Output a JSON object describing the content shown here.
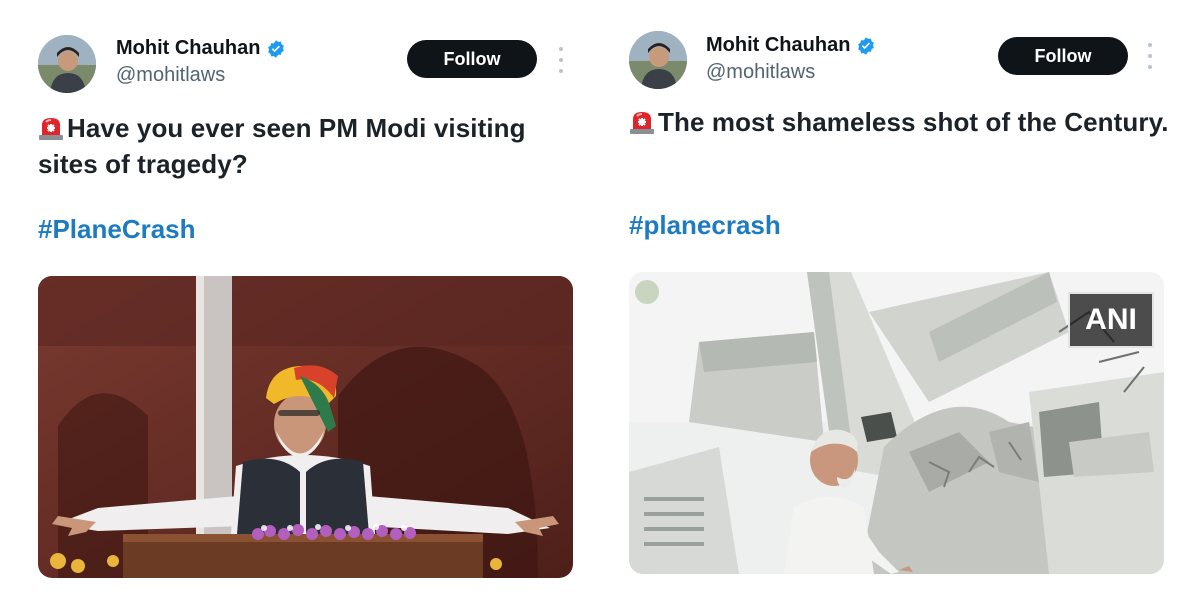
{
  "tweets": [
    {
      "author": {
        "display_name": "Mohit Chauhan",
        "handle": "@mohitlaws",
        "verified_icon": "verified-badge-icon"
      },
      "follow_label": "Follow",
      "text": "Have you ever seen PM Modi visiting sites of tragedy?",
      "text_prefix_icon": "police-siren-icon",
      "hashtag": "#PlaneCrash",
      "media": {
        "description_icon": "photo"
      }
    },
    {
      "author": {
        "display_name": "Mohit Chauhan",
        "handle": "@mohitlaws",
        "verified_icon": "verified-badge-icon"
      },
      "follow_label": "Follow",
      "text": "The most shameless shot of the Century.",
      "text_prefix_icon": "police-siren-icon",
      "hashtag": "#planecrash",
      "media": {
        "watermark": "ANI"
      }
    }
  ],
  "colors": {
    "follow_bg": "#0f1419",
    "hashtag": "#1d7bc2",
    "verified": "#1d9bf0",
    "handle": "#536471"
  }
}
